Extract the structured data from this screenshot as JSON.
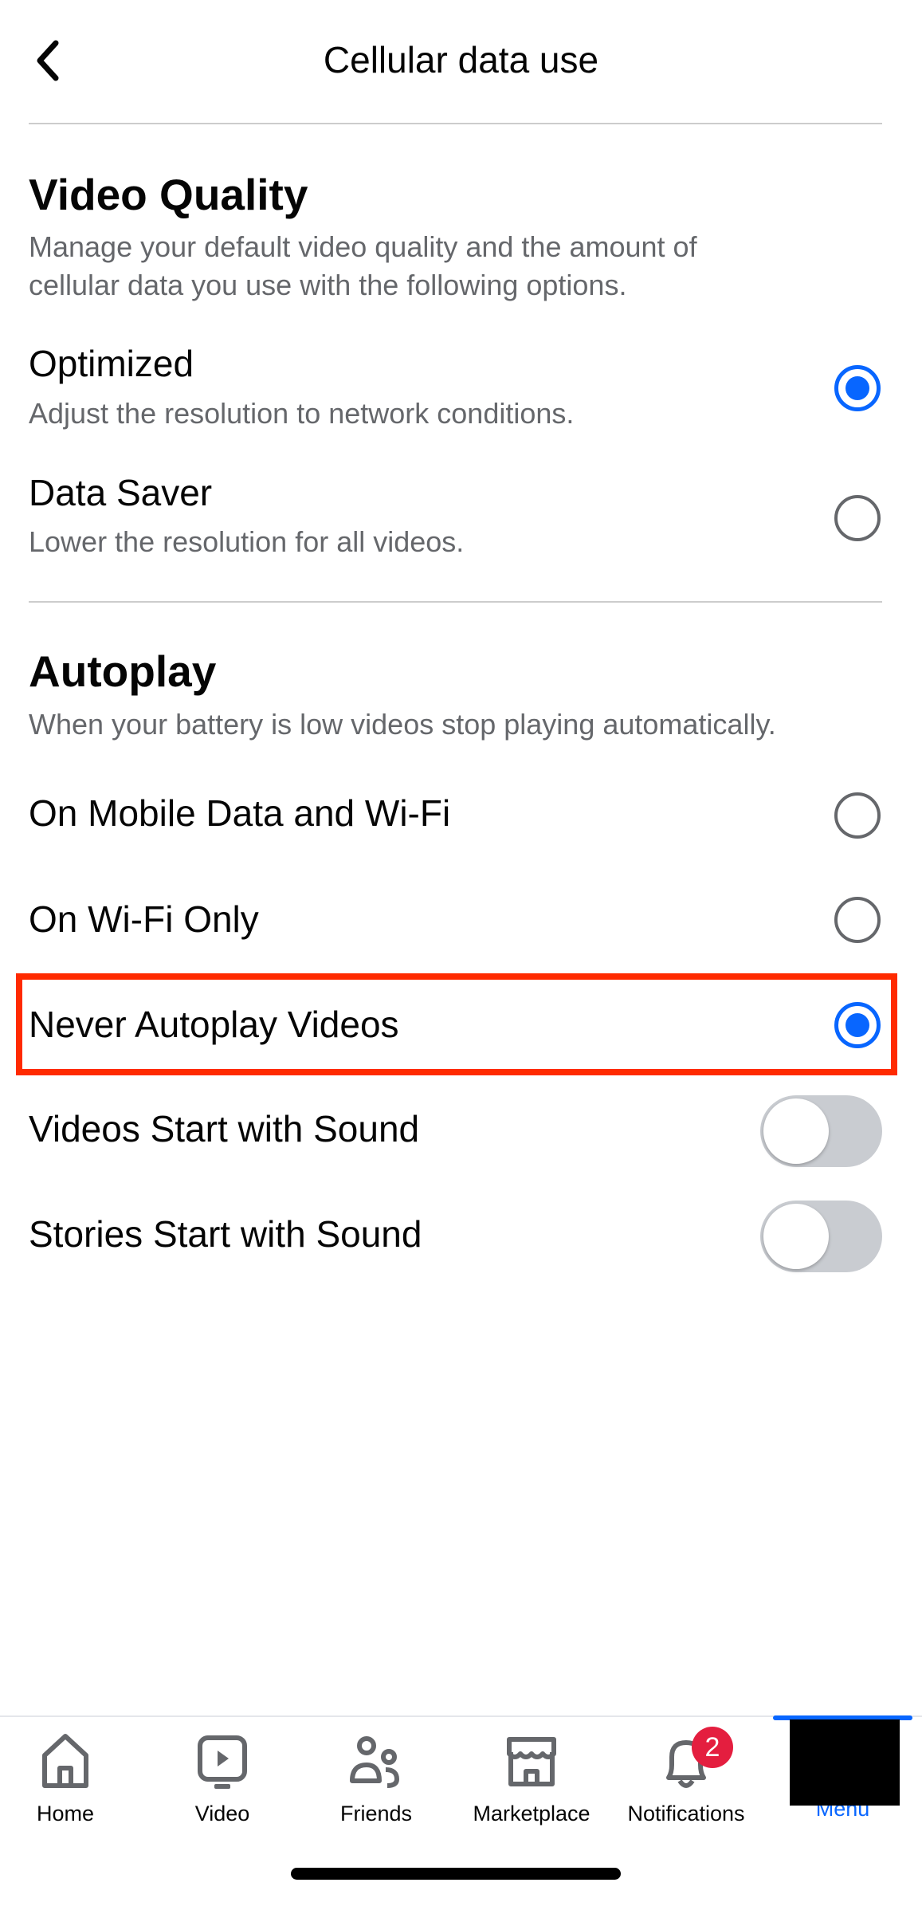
{
  "header": {
    "title": "Cellular data use",
    "back_icon": "chevron-left-icon"
  },
  "video_quality": {
    "heading": "Video Quality",
    "description_line1": "Manage your default video quality and the amount of",
    "description_line2": "cellular data you use with the following options.",
    "options": [
      {
        "label": "Optimized",
        "description": "Adjust the resolution to network conditions.",
        "selected": true
      },
      {
        "label": "Data Saver",
        "description": "Lower the resolution for all videos.",
        "selected": false
      }
    ]
  },
  "autoplay": {
    "heading": "Autoplay",
    "description": "When your battery is low videos stop playing automatically.",
    "options": [
      {
        "label": "On Mobile Data and Wi-Fi",
        "selected": false
      },
      {
        "label": "On Wi-Fi Only",
        "selected": false
      },
      {
        "label": "Never Autoplay Videos",
        "selected": true
      }
    ],
    "toggles": [
      {
        "label": "Videos Start with Sound",
        "on": false
      },
      {
        "label": "Stories Start with Sound",
        "on": false
      }
    ]
  },
  "highlight_color": "#ff2a00",
  "accent_color": "#0866ff",
  "bottom_nav": {
    "items": [
      {
        "label": "Home",
        "icon": "home-icon"
      },
      {
        "label": "Video",
        "icon": "video-icon"
      },
      {
        "label": "Friends",
        "icon": "friends-icon"
      },
      {
        "label": "Marketplace",
        "icon": "marketplace-icon"
      },
      {
        "label": "Notifications",
        "icon": "bell-icon",
        "badge": "2"
      },
      {
        "label": "Menu",
        "icon": "menu-icon",
        "active": true
      }
    ]
  }
}
